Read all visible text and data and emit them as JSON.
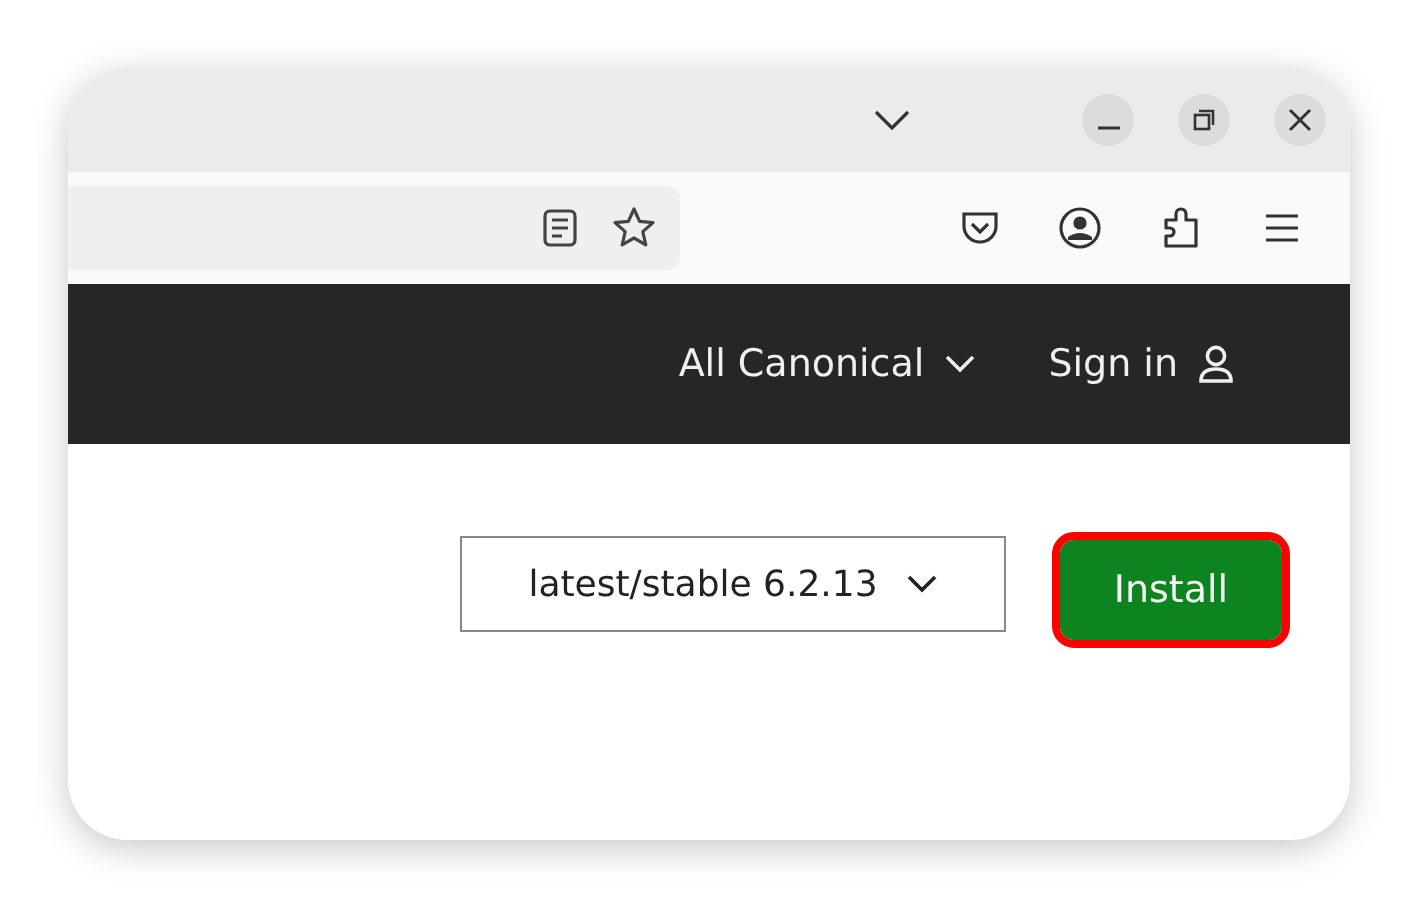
{
  "nav": {
    "items": [
      {
        "label": "All Canonical",
        "kind": "dropdown"
      },
      {
        "label": "Sign in",
        "kind": "account"
      }
    ]
  },
  "channel_select": {
    "value": "latest/stable 6.2.13"
  },
  "install_button": {
    "label": "Install",
    "highlighted": true
  }
}
